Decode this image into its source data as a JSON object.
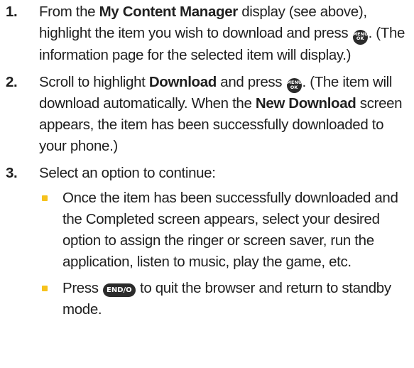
{
  "steps": [
    {
      "number": "1.",
      "t1": "From the ",
      "b1": "My Content Manager",
      "t2": " display (see above), highlight the item you wish to download and press ",
      "t3": ". (The information page for the selected item will display.)"
    },
    {
      "number": "2.",
      "t1": "Scroll to highlight ",
      "b1": "Download",
      "t2": " and press ",
      "t3": ". (The item will download automatically. When the ",
      "b2": "New Download",
      "t4": " screen appears, the item has been successfully downloaded to your phone.)"
    },
    {
      "number": "3.",
      "t1": "Select an option to continue:"
    }
  ],
  "bullets": [
    {
      "text": "Once the item has been successfully downloaded and the Completed screen appears, select your desired option to assign the ringer or screen saver, run the application, listen to music, play the game, etc."
    },
    {
      "t1": "Press ",
      "t2": " to quit the browser and return to standby mode."
    }
  ],
  "keys": {
    "menu_top": "MENU",
    "menu_bottom": "OK",
    "end": "END/O"
  },
  "colors": {
    "bullet": "#f6c21c",
    "key_fill": "#2b2b2b",
    "text": "#1f1f1f"
  },
  "icons": {
    "menu_ok_key": "menu-ok-key-icon",
    "end_key": "end-key-icon"
  }
}
